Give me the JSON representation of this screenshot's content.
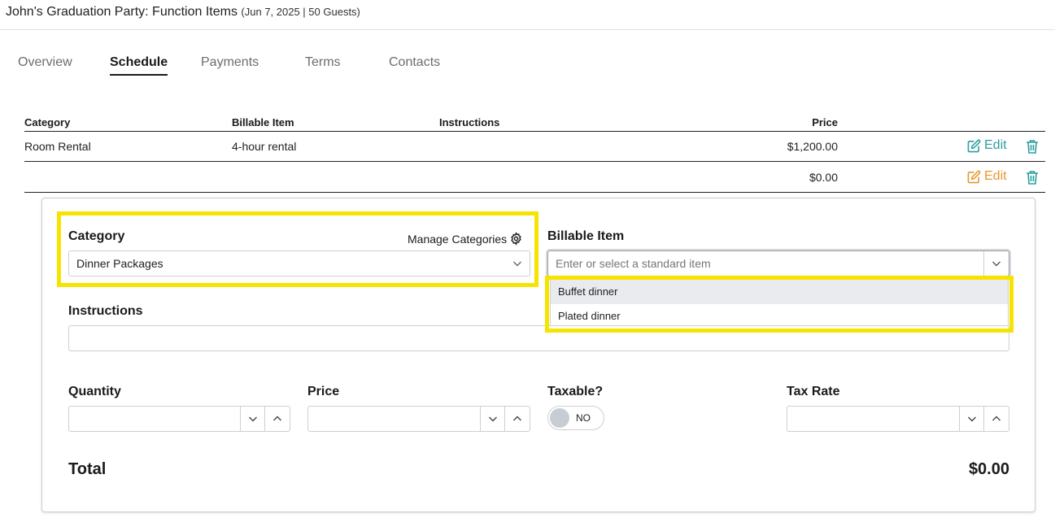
{
  "header": {
    "title": "John's Graduation Party: Function Items",
    "subtitle": "(Jun 7, 2025 | 50 Guests)"
  },
  "tabs": [
    {
      "label": "Overview",
      "active": false
    },
    {
      "label": "Schedule",
      "active": true
    },
    {
      "label": "Payments",
      "active": false
    },
    {
      "label": "Terms",
      "active": false
    },
    {
      "label": "Contacts",
      "active": false
    }
  ],
  "table": {
    "columns": [
      "Category",
      "Billable Item",
      "Instructions",
      "Price"
    ],
    "rows": [
      {
        "category": "Room Rental",
        "billable_item": "4-hour rental",
        "instructions": "",
        "price": "$1,200.00",
        "edit_label": "Edit"
      },
      {
        "category": "",
        "billable_item": "",
        "instructions": "",
        "price": "$0.00",
        "edit_label": "Edit"
      }
    ]
  },
  "form": {
    "category_label": "Category",
    "manage_categories": "Manage Categories",
    "category_value": "Dinner Packages",
    "billable_label": "Billable Item",
    "billable_placeholder": "Enter or select a standard item",
    "billable_options": [
      "Buffet dinner",
      "Plated dinner"
    ],
    "instructions_label": "Instructions",
    "quantity_label": "Quantity",
    "price_label": "Price",
    "taxable_label": "Taxable?",
    "taxable_value": "NO",
    "tax_rate_label": "Tax Rate",
    "total_label": "Total",
    "total_value": "$0.00"
  },
  "colors": {
    "teal_edit": "#2a9d9f",
    "orange_edit": "#e8962e",
    "highlight": "#f7e300"
  }
}
